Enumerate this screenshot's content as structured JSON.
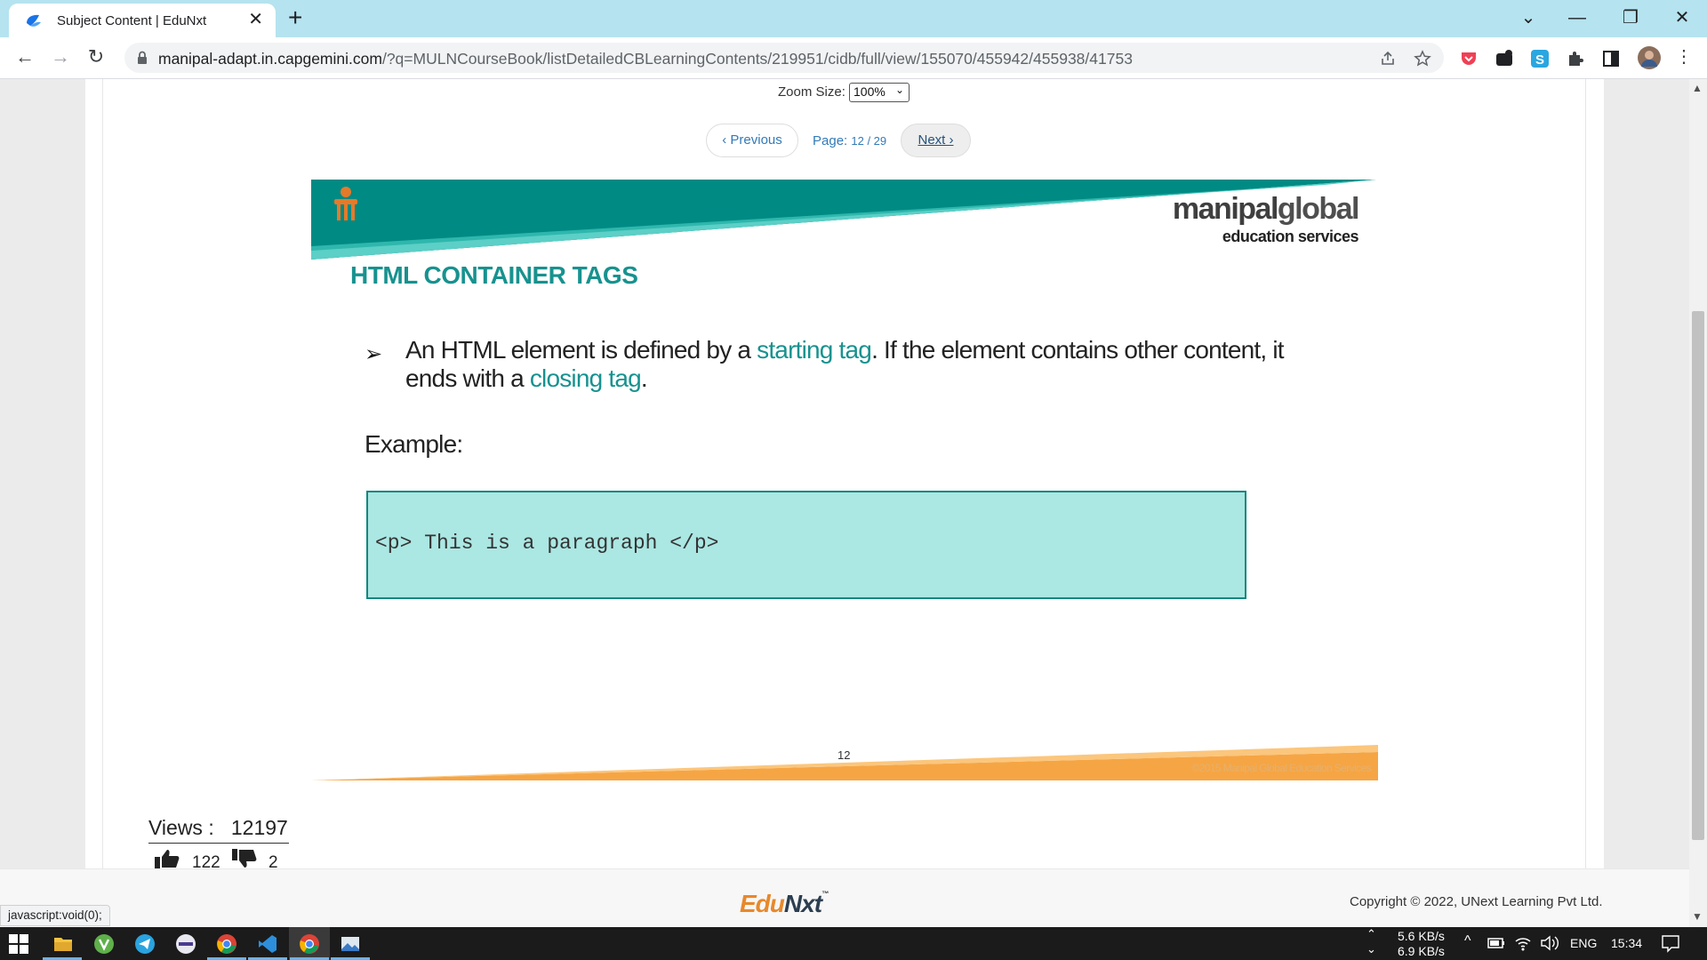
{
  "browser": {
    "tab_title": "Subject Content | EduNxt",
    "tab_close": "✕",
    "new_tab": "+",
    "url_host": "manipal-adapt.in.capgemini.com",
    "url_path": "/?q=MULNCourseBook/listDetailedCBLearningContents/219951/cidb/full/view/155070/455942/455938/41753",
    "window_controls": [
      "⌄",
      "—",
      "❐",
      "✕"
    ],
    "nav": {
      "back": "←",
      "forward": "→",
      "reload": "↻"
    }
  },
  "viewer": {
    "zoom_label": "Zoom Size:",
    "zoom_value": "100%",
    "prev_label": "‹ Previous",
    "page_label": "Page:",
    "page_value": "12 / 29",
    "next_label": "Next ›"
  },
  "slide": {
    "brand_main_a": "manipal",
    "brand_main_b": "global",
    "brand_sub": "education services",
    "title": "HTML CONTAINER TAGS",
    "bullet_arrow": "➢",
    "bullet_part1": "An HTML element is defined by a ",
    "bullet_hl1": "starting tag",
    "bullet_part2": ". If the element contains other content, it ends with a ",
    "bullet_hl2": "closing tag",
    "bullet_part3": ".",
    "example_label": "Example:",
    "code": "<p> This is a paragraph </p>",
    "slide_number": "12",
    "slide_copyright": "©2015 Manipal Global Education Services",
    "colors": {
      "teal": "#17928f",
      "code_bg": "#abe7e3",
      "orange": "#f6a544"
    }
  },
  "stats": {
    "views_label": "Views :",
    "views_value": "12197",
    "likes": "122",
    "dislikes": "2"
  },
  "footer": {
    "logo_a": "Edu",
    "logo_b": "N",
    "logo_c": "xt",
    "logo_tm": "™",
    "copyright": "Copyright © 2022, UNext Learning Pvt Ltd.",
    "status_url": "javascript:void(0);"
  },
  "taskbar": {
    "net_up": "5.6 KB/s",
    "net_down": "6.9 KB/s",
    "language": "ENG",
    "time": "15:34",
    "apps": [
      "windows-start-icon",
      "file-explorer-icon",
      "app-green-icon",
      "telegram-icon",
      "app-stack-icon",
      "chrome-icon",
      "vscode-icon",
      "chrome-active-icon",
      "photos-icon"
    ]
  }
}
